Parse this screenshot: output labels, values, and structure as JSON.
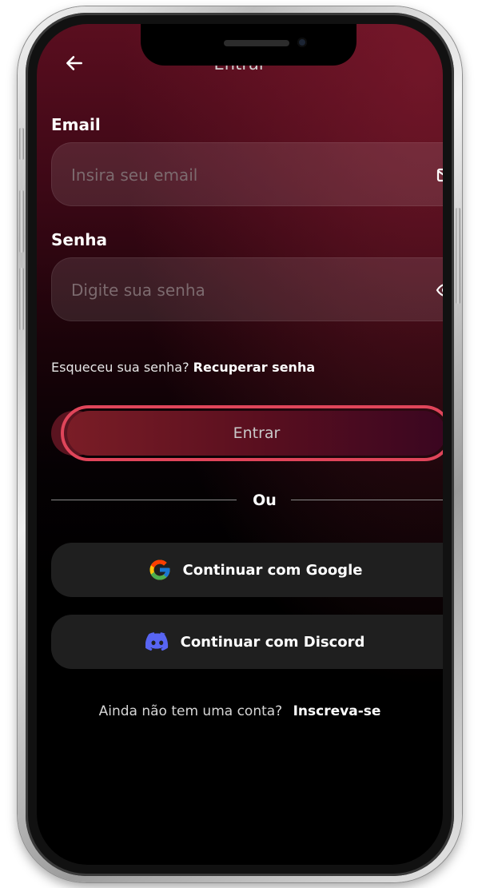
{
  "header": {
    "title": "Entrar"
  },
  "email": {
    "label": "Email",
    "placeholder": "Insira seu email",
    "value": "",
    "icon": "mail-icon"
  },
  "password": {
    "label": "Senha",
    "placeholder": "Digite sua senha",
    "value": "",
    "icon": "eye-icon"
  },
  "forgot": {
    "question": "Esqueceu sua senha?",
    "link": "Recuperar senha"
  },
  "login": {
    "label": "Entrar",
    "highlight_color": "#e0455a"
  },
  "divider": {
    "label": "Ou"
  },
  "social": {
    "google_label": "Continuar com Google",
    "discord_label": "Continuar com Discord"
  },
  "signup": {
    "question": "Ainda não tem uma conta?",
    "link": "Inscreva-se"
  },
  "colors": {
    "background_top": "#5a0e1f",
    "background_bottom": "#000000",
    "accent_outline": "#e0455a",
    "social_bg": "#1f1f1f"
  }
}
